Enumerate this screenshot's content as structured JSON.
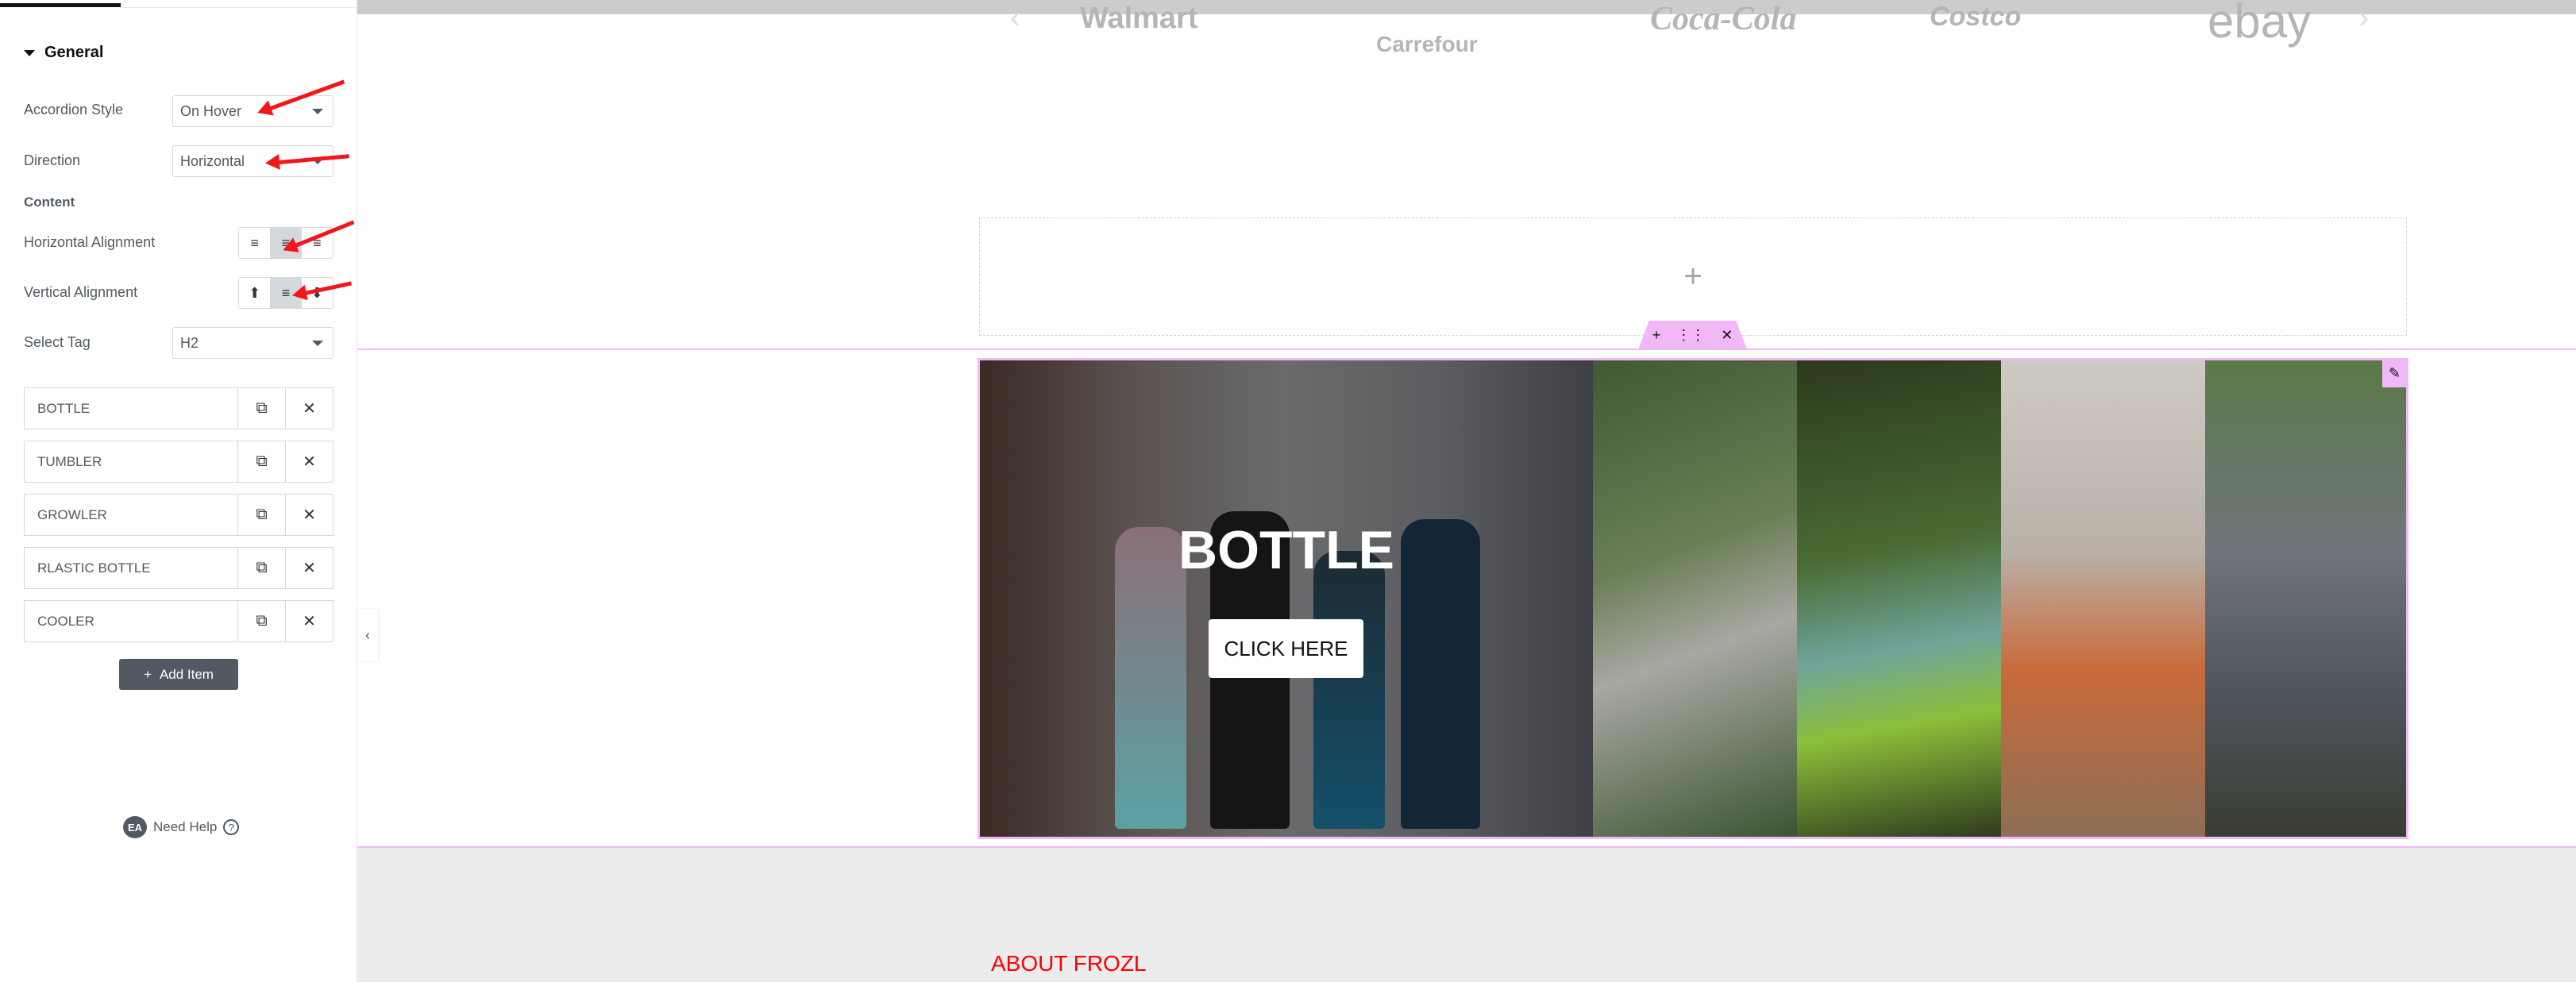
{
  "sidebar": {
    "section_title": "General",
    "accordion_style": {
      "label": "Accordion Style",
      "value": "On Hover"
    },
    "direction": {
      "label": "Direction",
      "value": "Horizontal"
    },
    "content_heading": "Content",
    "horizontal_alignment": {
      "label": "Horizontal Alignment",
      "selected": "center"
    },
    "vertical_alignment": {
      "label": "Vertical Alignment",
      "selected": "middle"
    },
    "select_tag": {
      "label": "Select Tag",
      "value": "H2"
    },
    "items": [
      {
        "label": "BOTTLE"
      },
      {
        "label": "TUMBLER"
      },
      {
        "label": "GROWLER"
      },
      {
        "label": "RLASTIC BOTTLE"
      },
      {
        "label": "COOLER"
      }
    ],
    "add_item": "Add Item",
    "help_badge": "EA",
    "help": "Need Help"
  },
  "canvas": {
    "logos": [
      "Walmart",
      "Carrefour",
      "Coca-Cola",
      "Costco",
      "ebay"
    ],
    "accordion": {
      "active_title": "BOTTLE",
      "button": "CLICK HERE"
    },
    "about_heading": "ABOUT FROZL"
  },
  "colors": {
    "accent_pink": "#f0b8f7",
    "annotation_red": "#f2161a",
    "about_red": "#ff0000",
    "panel_dark": "#515962"
  }
}
